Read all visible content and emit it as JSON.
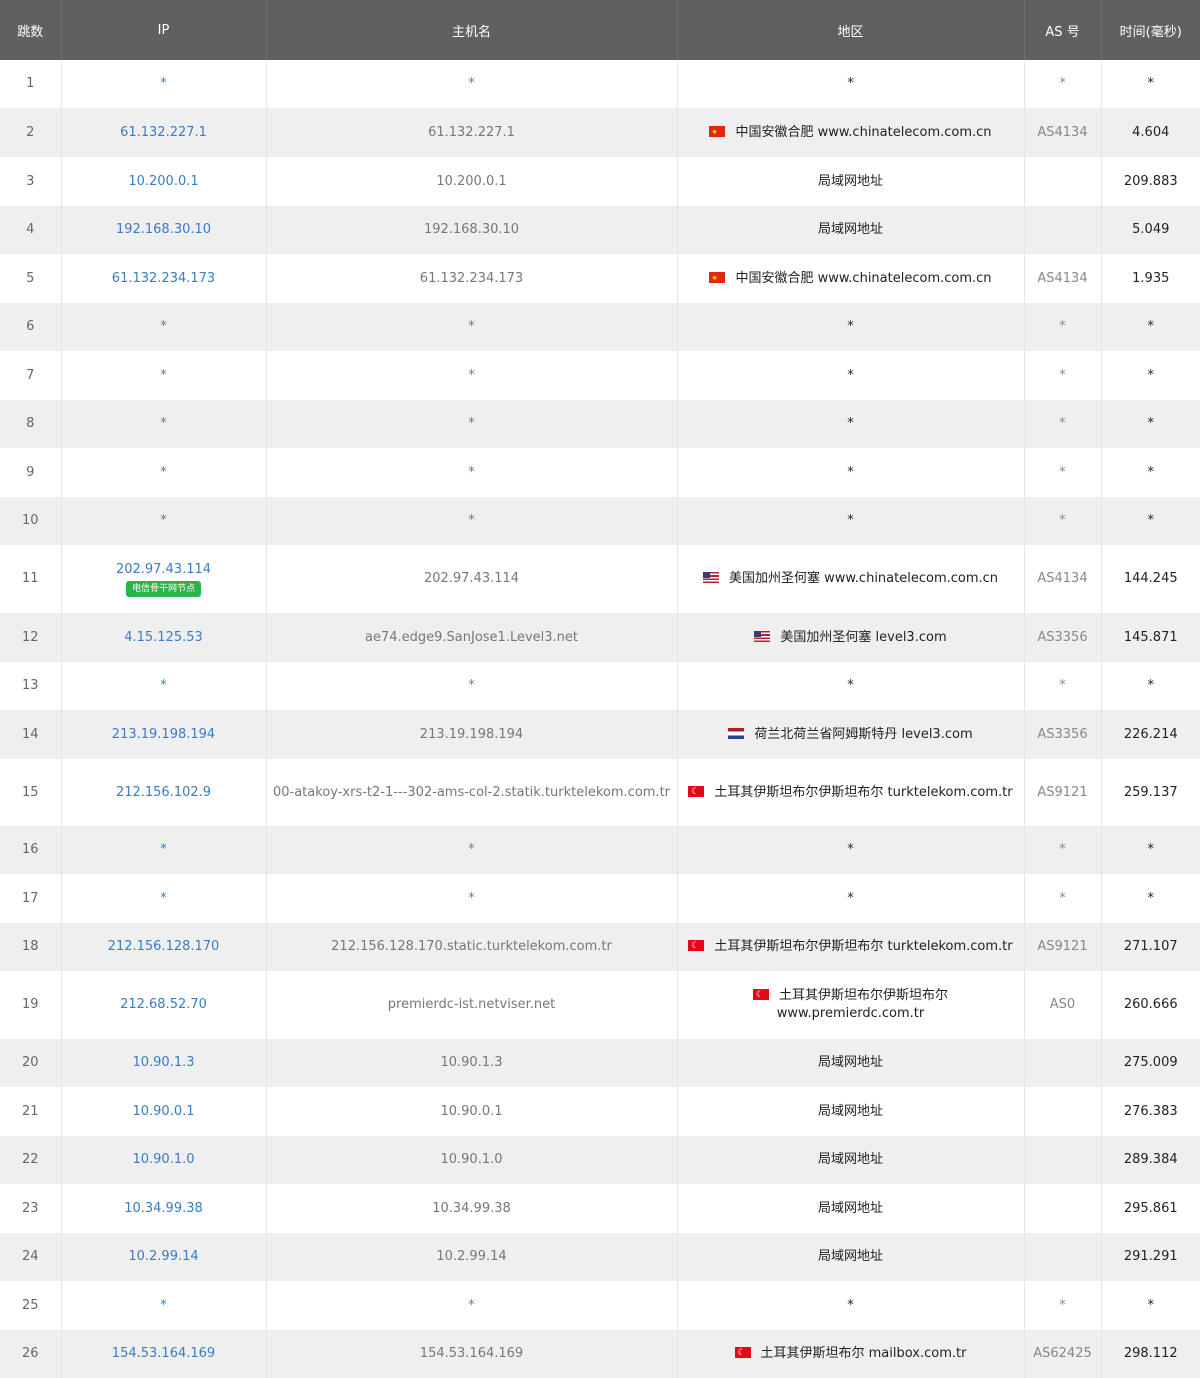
{
  "header": {
    "hop": "跳数",
    "ip": "IP",
    "host": "主机名",
    "geo": "地区",
    "as": "AS 号",
    "time": "时间(毫秒)"
  },
  "rows": [
    {
      "hop": "1",
      "ip": "*",
      "host": "*",
      "flag": "",
      "geo": "*",
      "as": "*",
      "time": "*",
      "h": 48
    },
    {
      "hop": "2",
      "ip": "61.132.227.1",
      "host": "61.132.227.1",
      "flag": "cn",
      "geo": "中国安徽合肥 www.chinatelecom.com.cn",
      "as": "AS4134",
      "time": "4.604",
      "h": 49
    },
    {
      "hop": "3",
      "ip": "10.200.0.1",
      "host": "10.200.0.1",
      "flag": "",
      "geo": "局域网地址",
      "as": "",
      "time": "209.883",
      "h": 49
    },
    {
      "hop": "4",
      "ip": "192.168.30.10",
      "host": "192.168.30.10",
      "flag": "",
      "geo": "局域网地址",
      "as": "",
      "time": "5.049",
      "h": 48
    },
    {
      "hop": "5",
      "ip": "61.132.234.173",
      "host": "61.132.234.173",
      "flag": "cn",
      "geo": "中国安徽合肥 www.chinatelecom.com.cn",
      "as": "AS4134",
      "time": "1.935",
      "h": 49
    },
    {
      "hop": "6",
      "ip": "*",
      "host": "*",
      "flag": "",
      "geo": "*",
      "as": "*",
      "time": "*",
      "h": 48
    },
    {
      "hop": "7",
      "ip": "*",
      "host": "*",
      "flag": "",
      "geo": "*",
      "as": "*",
      "time": "*",
      "h": 49
    },
    {
      "hop": "8",
      "ip": "*",
      "host": "*",
      "flag": "",
      "geo": "*",
      "as": "*",
      "time": "*",
      "h": 48
    },
    {
      "hop": "9",
      "ip": "*",
      "host": "*",
      "flag": "",
      "geo": "*",
      "as": "*",
      "time": "*",
      "h": 49
    },
    {
      "hop": "10",
      "ip": "*",
      "host": "*",
      "flag": "",
      "geo": "*",
      "as": "*",
      "time": "*",
      "h": 48
    },
    {
      "hop": "11",
      "ip": "202.97.43.114",
      "badge": "电信骨干网节点",
      "host": "202.97.43.114",
      "flag": "us",
      "geo": "美国加州圣何塞 www.chinatelecom.com.cn",
      "as": "AS4134",
      "time": "144.245",
      "h": 68
    },
    {
      "hop": "12",
      "ip": "4.15.125.53",
      "host": "ae74.edge9.SanJose1.Level3.net",
      "flag": "us",
      "geo": "美国加州圣何塞 level3.com",
      "as": "AS3356",
      "time": "145.871",
      "h": 49
    },
    {
      "hop": "13",
      "ip": "*",
      "host": "*",
      "flag": "",
      "geo": "*",
      "as": "*",
      "time": "*",
      "h": 48
    },
    {
      "hop": "14",
      "ip": "213.19.198.194",
      "host": "213.19.198.194",
      "flag": "nl",
      "geo": "荷兰北荷兰省阿姆斯特丹 level3.com",
      "as": "AS3356",
      "time": "226.214",
      "h": 49
    },
    {
      "hop": "15",
      "ip": "212.156.102.9",
      "host": "00-atakoy-xrs-t2-1---302-ams-col-2.statik.turktelekom.com.tr",
      "flag": "tr",
      "geo": "土耳其伊斯坦布尔伊斯坦布尔 turktelekom.com.tr",
      "as": "AS9121",
      "time": "259.137",
      "h": 67
    },
    {
      "hop": "16",
      "ip": "*",
      "host": "*",
      "flag": "",
      "geo": "*",
      "as": "*",
      "time": "*",
      "h": 48
    },
    {
      "hop": "17",
      "ip": "*",
      "host": "*",
      "flag": "",
      "geo": "*",
      "as": "*",
      "time": "*",
      "h": 49
    },
    {
      "hop": "18",
      "ip": "212.156.128.170",
      "host": "212.156.128.170.static.turktelekom.com.tr",
      "flag": "tr",
      "geo": "土耳其伊斯坦布尔伊斯坦布尔 turktelekom.com.tr",
      "as": "AS9121",
      "time": "271.107",
      "h": 48
    },
    {
      "hop": "19",
      "ip": "212.68.52.70",
      "host": "premierdc-ist.netviser.net",
      "flag": "tr",
      "geo": "土耳其伊斯坦布尔伊斯坦布尔 www.premierdc.com.tr",
      "as": "AS0",
      "time": "260.666",
      "h": 68
    },
    {
      "hop": "20",
      "ip": "10.90.1.3",
      "host": "10.90.1.3",
      "flag": "",
      "geo": "局域网地址",
      "as": "",
      "time": "275.009",
      "h": 48
    },
    {
      "hop": "21",
      "ip": "10.90.0.1",
      "host": "10.90.0.1",
      "flag": "",
      "geo": "局域网地址",
      "as": "",
      "time": "276.383",
      "h": 49
    },
    {
      "hop": "22",
      "ip": "10.90.1.0",
      "host": "10.90.1.0",
      "flag": "",
      "geo": "局域网地址",
      "as": "",
      "time": "289.384",
      "h": 48
    },
    {
      "hop": "23",
      "ip": "10.34.99.38",
      "host": "10.34.99.38",
      "flag": "",
      "geo": "局域网地址",
      "as": "",
      "time": "295.861",
      "h": 49
    },
    {
      "hop": "24",
      "ip": "10.2.99.14",
      "host": "10.2.99.14",
      "flag": "",
      "geo": "局域网地址",
      "as": "",
      "time": "291.291",
      "h": 48
    },
    {
      "hop": "25",
      "ip": "*",
      "host": "*",
      "flag": "",
      "geo": "*",
      "as": "*",
      "time": "*",
      "h": 49
    },
    {
      "hop": "26",
      "ip": "154.53.164.169",
      "host": "154.53.164.169",
      "flag": "tr",
      "geo": "土耳其伊斯坦布尔 mailbox.com.tr",
      "as": "AS62425",
      "time": "298.112",
      "h": 48
    }
  ]
}
